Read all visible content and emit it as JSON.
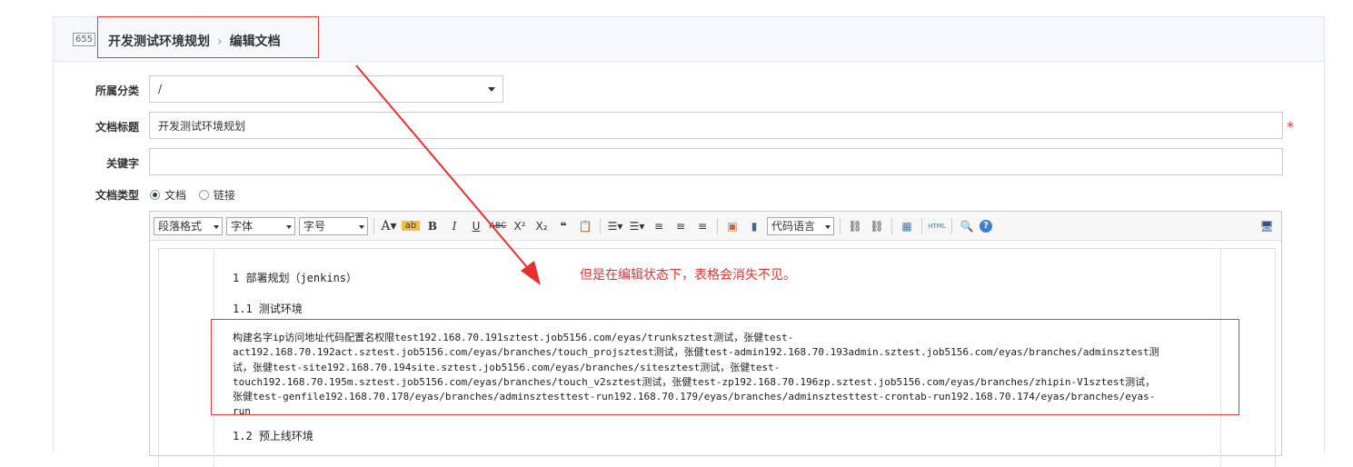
{
  "header": {
    "id_badge": "655",
    "crumb_parent": "开发测试环境规划",
    "crumb_sep": "›",
    "crumb_current": "编辑文档"
  },
  "form": {
    "category_label": "所属分类",
    "category_value": "/",
    "title_label": "文档标题",
    "title_value": "开发测试环境规划",
    "required_mark": "*",
    "keywords_label": "关键字",
    "keywords_value": "",
    "doctype_label": "文档类型",
    "doctype_options": [
      "文档",
      "链接"
    ],
    "doctype_selected": "文档"
  },
  "toolbar": {
    "paragraph": "段落格式",
    "font": "字体",
    "size": "字号",
    "code_lang": "代码语言",
    "html": "HTML"
  },
  "content": {
    "h1": "1 部署规划（jenkins）",
    "h11": "1.1 测试环境",
    "lines": [
      "构建名字ip访问地址代码配置名权限test192.168.70.191sztest.job5156.com/eyas/trunksztest测试，张健test-",
      "act192.168.70.192act.sztest.job5156.com/eyas/branches/touch_projsztest测试，张健test-admin192.168.70.193admin.sztest.job5156.com/eyas/branches/adminsztest测",
      "试，张健test-site192.168.70.194site.sztest.job5156.com/eyas/branches/sitesztest测试，张健test-",
      "touch192.168.70.195m.sztest.job5156.com/eyas/branches/touch_v2sztest测试，张健test-zp192.168.70.196zp.sztest.job5156.com/eyas/branches/zhipin-V1sztest测试，",
      "张健test-genfile192.168.70.178/eyas/branches/adminsztesttest-run192.168.70.179/eyas/branches/adminsztesttest-crontab-run192.168.70.174/eyas/branches/eyas-",
      "run"
    ],
    "h12": "1.2 预上线环境"
  },
  "annotation": {
    "note": "但是在编辑状态下，表格会消失不见。",
    "color": "#e8302f"
  }
}
